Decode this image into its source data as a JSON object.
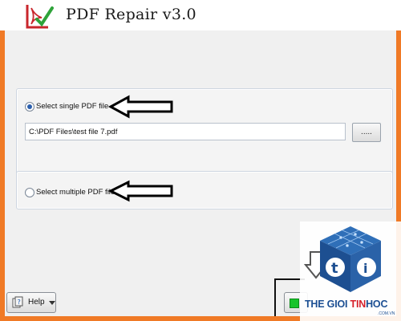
{
  "window": {
    "title": "PDF Repair v3.0"
  },
  "options": {
    "single": {
      "label": "Select single PDF file",
      "selected": true,
      "path_value": "C:\\PDF Files\\test file 7.pdf",
      "browse_label": "....."
    },
    "multiple": {
      "label": "Select multiple PDF files",
      "selected": false
    }
  },
  "footer": {
    "help_label": "Help"
  },
  "watermark": {
    "brand_part1": "THE GIOI ",
    "brand_part2": "TIN",
    "brand_part3": "HOC",
    "domain": ".COM.VN"
  },
  "colors": {
    "frame": "#f07a26",
    "brand_blue": "#1c4f93",
    "brand_red": "#d6202a",
    "start_green": "#18c42b"
  }
}
